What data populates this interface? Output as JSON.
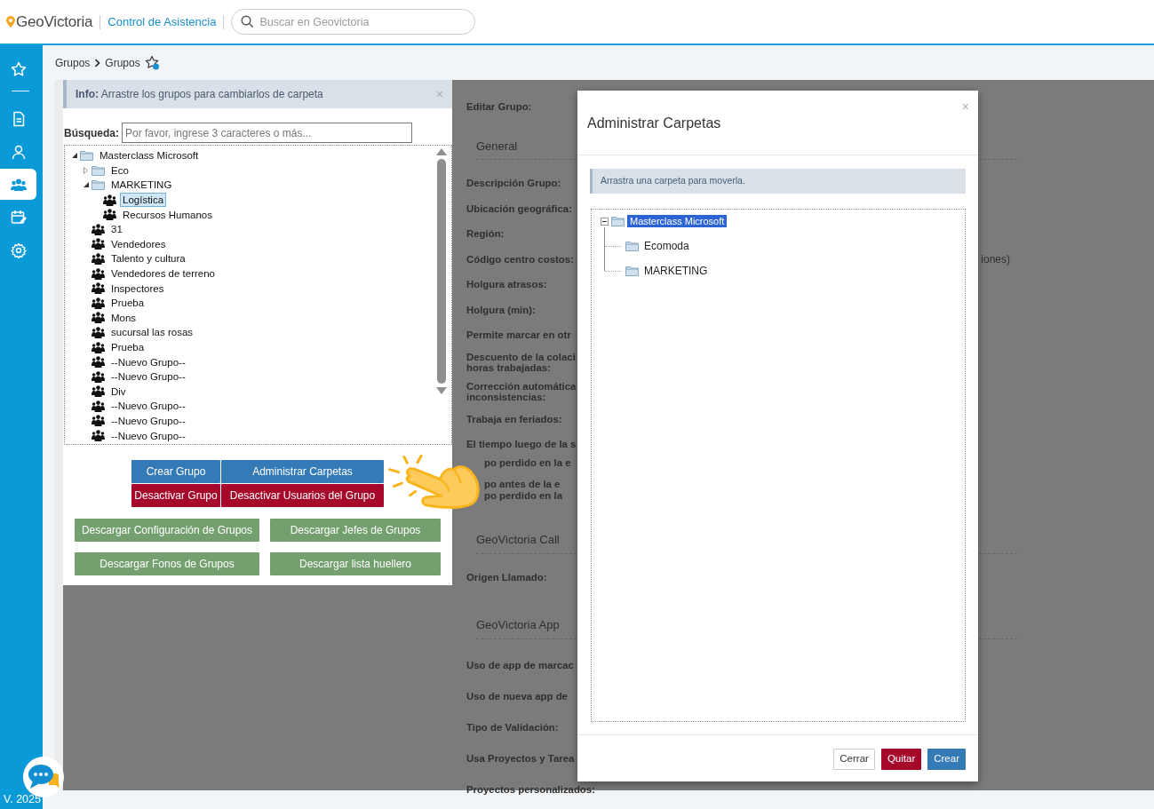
{
  "header": {
    "brand": "GeoVictoria",
    "module": "Control de Asistencia",
    "search": {
      "placeholder": "Buscar en Geovictoria"
    }
  },
  "sidebar": {
    "items": [
      {
        "kind": "star",
        "selected": false
      },
      {
        "kind": "document",
        "selected": false
      },
      {
        "kind": "person",
        "selected": false
      },
      {
        "kind": "people",
        "selected": true
      },
      {
        "kind": "calendar",
        "selected": false
      },
      {
        "kind": "gear",
        "selected": false
      }
    ],
    "version": "V. 2025"
  },
  "breadcrumb": [
    "Grupos",
    "Grupos"
  ],
  "groups_panel": {
    "info": {
      "text": "**Info:** Arrastre los grupos para cambiarlos de carpeta",
      "close": "×"
    },
    "search": {
      "label": "Búsqueda:",
      "placeholder": "Por favor, ingrese 3 caracteres o más..."
    },
    "tree": [
      {
        "kind": "folder",
        "label": "Masterclass Microsoft",
        "expanded": true,
        "selected": false,
        "children": [
          {
            "kind": "folder",
            "label": "Eco",
            "expanded": false,
            "selected": false
          },
          {
            "kind": "folder",
            "label": "MARKETING",
            "expanded": true,
            "selected": false,
            "children": [
              {
                "kind": "group",
                "label": "Logística",
                "selected": true
              },
              {
                "kind": "group",
                "label": "Recursos Humanos",
                "selected": false
              }
            ]
          },
          {
            "kind": "group",
            "label": "31",
            "selected": false
          },
          {
            "kind": "group",
            "label": "Vendedores",
            "selected": false
          },
          {
            "kind": "group",
            "label": "Talento y cultura",
            "selected": false
          },
          {
            "kind": "group",
            "label": "Vendedores de terreno",
            "selected": false
          },
          {
            "kind": "group",
            "label": "Inspectores",
            "selected": false
          },
          {
            "kind": "group",
            "label": "Prueba",
            "selected": false
          },
          {
            "kind": "group",
            "label": "Mons",
            "selected": false
          },
          {
            "kind": "group",
            "label": "sucursal las rosas",
            "selected": false
          },
          {
            "kind": "group",
            "label": "Prueba",
            "selected": false
          },
          {
            "kind": "group",
            "label": "--Nuevo Grupo--",
            "selected": false
          },
          {
            "kind": "group",
            "label": "--Nuevo Grupo--",
            "selected": false
          },
          {
            "kind": "group",
            "label": "Div",
            "selected": false
          },
          {
            "kind": "group",
            "label": "--Nuevo Grupo--",
            "selected": false
          },
          {
            "kind": "group",
            "label": "--Nuevo Grupo--",
            "selected": false
          },
          {
            "kind": "group",
            "label": "--Nuevo Grupo--",
            "selected": false
          }
        ]
      }
    ],
    "buttons": [
      {
        "label": "Crear Grupo",
        "kind": "primary"
      },
      {
        "label": "Administrar Carpetas",
        "kind": "primary"
      },
      {
        "label": "Desactivar Grupo",
        "kind": "danger"
      },
      {
        "label": "Desactivar Usuarios del Grupo",
        "kind": "danger"
      }
    ],
    "downloads": [
      "Descargar Configuración de Grupos",
      "Descargar Jefes de Grupos",
      "Descargar Fonos de Grupos",
      "Descargar lista huellero"
    ]
  },
  "edit_form": {
    "title": "Editar Grupo:",
    "rows": [
      {
        "kind": "section",
        "lines": [
          "General"
        ]
      },
      {
        "kind": "label",
        "lines": [
          "Descripción Grupo:"
        ]
      },
      {
        "kind": "label",
        "lines": [
          "Ubicación geográfica:"
        ]
      },
      {
        "kind": "label",
        "lines": [
          "Región:"
        ]
      },
      {
        "kind": "label",
        "lines": [
          "Código centro costos:"
        ],
        "note": "iones)"
      },
      {
        "kind": "label",
        "lines": [
          "Holgura atrasos:"
        ]
      },
      {
        "kind": "label",
        "lines": [
          "Holgura (min):"
        ]
      },
      {
        "kind": "label",
        "lines": [
          "Permite marcar en otr"
        ]
      },
      {
        "kind": "label",
        "lines": [
          "Descuento de la colaci",
          "horas trabajadas:"
        ]
      },
      {
        "kind": "label",
        "lines": [
          "Corrección automática",
          "inconsistencias:"
        ]
      },
      {
        "kind": "label",
        "lines": [
          "Trabaja en feriados:"
        ]
      },
      {
        "kind": "label",
        "lines": [
          "El tiempo luego de la s"
        ]
      },
      {
        "kind": "cut_left",
        "lines": [
          "po perdido en la e"
        ]
      },
      {
        "kind": "cut_left",
        "lines": [
          "po antes de la e",
          "po perdido en la"
        ]
      },
      {
        "kind": "section",
        "lines": [
          "GeoVictoria Call"
        ]
      },
      {
        "kind": "label",
        "lines": [
          "Origen Llamado:"
        ]
      },
      {
        "kind": "section",
        "lines": [
          "GeoVictoria App"
        ]
      },
      {
        "kind": "label",
        "lines": [
          "Uso de app de marcac"
        ]
      },
      {
        "kind": "label",
        "lines": [
          "Uso de nueva app de"
        ]
      },
      {
        "kind": "label",
        "lines": [
          "Tipo de Validación:"
        ]
      },
      {
        "kind": "label",
        "lines": [
          "Usa Proyectos y Tarea"
        ]
      },
      {
        "kind": "label",
        "lines": [
          "Proyectos personalizados:"
        ]
      }
    ]
  },
  "modal": {
    "title": "Administrar Carpetas",
    "close": "×",
    "info": "Arrastra una carpeta para moverla.",
    "tree": [
      {
        "label": "Masterclass Microsoft",
        "expanded": true,
        "selected": true,
        "children": [
          {
            "label": "Ecomoda",
            "selected": false
          },
          {
            "label": "MARKETING",
            "selected": false
          }
        ]
      }
    ],
    "buttons": [
      {
        "label": "Cerrar",
        "kind": "default"
      },
      {
        "label": "Quitar",
        "kind": "danger"
      },
      {
        "label": "Crear",
        "kind": "primary"
      }
    ]
  }
}
